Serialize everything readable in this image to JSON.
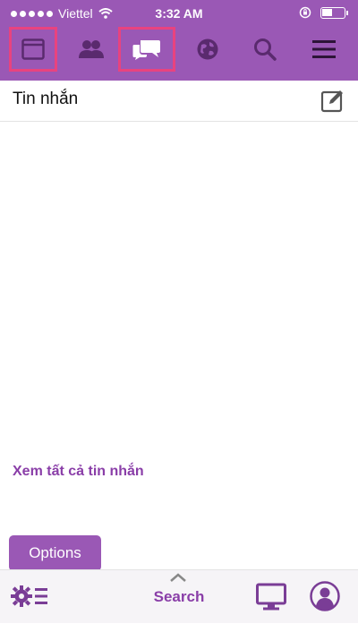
{
  "status_bar": {
    "carrier": "Viettel",
    "time": "3:32 AM"
  },
  "nav": {
    "items": [
      {
        "icon": "newsfeed-icon",
        "highlighted": true
      },
      {
        "icon": "friends-icon",
        "highlighted": false
      },
      {
        "icon": "messages-icon",
        "highlighted": true
      },
      {
        "icon": "globe-icon",
        "highlighted": false
      },
      {
        "icon": "search-icon",
        "highlighted": false
      },
      {
        "icon": "menu-icon",
        "highlighted": false
      }
    ]
  },
  "header": {
    "title": "Tin nhắn",
    "compose_icon": "compose-icon"
  },
  "content": {
    "see_all_link": "Xem tất cả tin nhắn"
  },
  "tooltip": {
    "label": "Options"
  },
  "bottom_bar": {
    "search_label": "Search",
    "icons": [
      "options-icon",
      "chevron-up-icon",
      "desktop-icon",
      "profile-icon"
    ]
  },
  "colors": {
    "brand": "#9a58b5",
    "highlight": "#e8437f",
    "link": "#8a3ea8"
  }
}
